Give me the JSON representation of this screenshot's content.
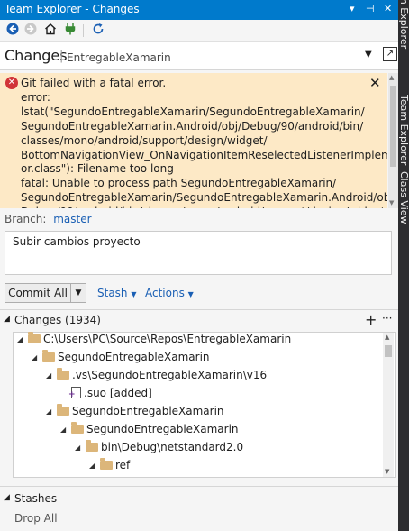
{
  "window": {
    "title": "Team Explorer - Changes"
  },
  "toolbar": {
    "icons": [
      "back-icon",
      "forward-icon",
      "home-icon",
      "connect-icon",
      "refresh-icon"
    ]
  },
  "header": {
    "title": "Changes",
    "repo": "EntregableXamarin"
  },
  "error": {
    "message": "Git failed with a fatal error.\nerror: lstat(\"SegundoEntregableXamarin/SegundoEntregableXamarin/\nSegundoEntregableXamarin.Android/obj/Debug/90/android/bin/\nclasses/mono/android/support/design/widget/\nBottomNavigationView_OnNavigationItemReselectedListenerImplement\nor.class\"): Filename too long\nfatal: Unable to process path SegundoEntregableXamarin/\nSegundoEntregableXamarin/SegundoEntregableXamarin.Android/obj/\nDebug/90/android/bin/classes/mono/android/support/design/widget/\nBottomNavigationView_OnNavigationItemReselectedListenerImplement"
  },
  "branch": {
    "label": "Branch:",
    "value": "master"
  },
  "commit": {
    "message": "Subir cambios proyecto",
    "button": "Commit All",
    "stash": "Stash",
    "actions": "Actions"
  },
  "changes": {
    "header": "Changes (1934)",
    "items": [
      {
        "label": "C:\\Users\\PC\\Source\\Repos\\EntregableXamarin",
        "type": "folder"
      },
      {
        "label": "SegundoEntregableXamarin",
        "type": "folder"
      },
      {
        "label": ".vs\\SegundoEntregableXamarin\\v16",
        "type": "folder"
      },
      {
        "label": ".suo [added]",
        "type": "file"
      },
      {
        "label": "SegundoEntregableXamarin",
        "type": "folder"
      },
      {
        "label": "SegundoEntregableXamarin",
        "type": "folder"
      },
      {
        "label": "bin\\Debug\\netstandard2.0",
        "type": "folder"
      },
      {
        "label": "ref",
        "type": "folder"
      }
    ]
  },
  "stashes": {
    "header": "Stashes",
    "drop_all": "Drop All"
  },
  "side_tabs": [
    "Solution Explorer",
    "Team Explorer",
    "Class View"
  ],
  "colors": {
    "title_bar": "#007acc",
    "error_bg": "#fde9c6",
    "link": "#1a5fb4",
    "error_icon": "#d13438"
  }
}
